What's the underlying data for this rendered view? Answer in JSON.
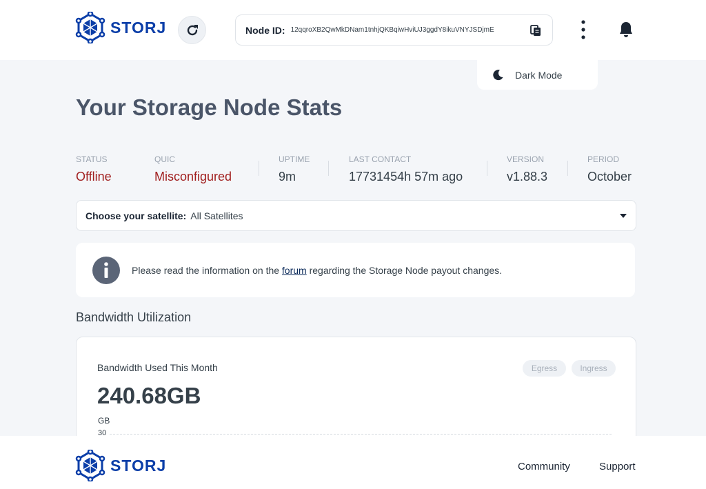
{
  "brand": {
    "name": "STORJ",
    "color": "#0b3ea8"
  },
  "header": {
    "node_id_label": "Node ID:",
    "node_id_value": "12qqroXB2QwMkDNam1tnhjQKBqiwHviUJ3ggdY8ikuVNYJSDjmE",
    "menu": {
      "dark_mode_label": "Dark Mode"
    }
  },
  "page_title": "Your Storage Node Stats",
  "stats": [
    {
      "label": "STATUS",
      "value": "Offline"
    },
    {
      "label": "QUIC",
      "value": "Misconfigured"
    },
    {
      "label": "UPTIME",
      "value": "9m"
    },
    {
      "label": "LAST CONTACT",
      "value": "17731454h 57m ago"
    },
    {
      "label": "VERSION",
      "value": "v1.88.3"
    },
    {
      "label": "PERIOD",
      "value": "October"
    }
  ],
  "satellite": {
    "label": "Choose your satellite:",
    "value": "All Satellites"
  },
  "notice": {
    "before": "Please read the information on the",
    "link": "forum",
    "after": "regarding the Storage Node payout changes."
  },
  "bandwidth": {
    "section_title": "Bandwidth Utilization",
    "card_title": "Bandwidth Used This Month",
    "total": "240.68GB",
    "unit": "GB",
    "axis_tick": "30",
    "toggles": {
      "egress": "Egress",
      "ingress": "Ingress"
    }
  },
  "footer": {
    "links": {
      "community": "Community",
      "support": "Support"
    }
  },
  "colors": {
    "error": "#a11f1f",
    "background": "#f4f6f9",
    "text": "#354049"
  }
}
